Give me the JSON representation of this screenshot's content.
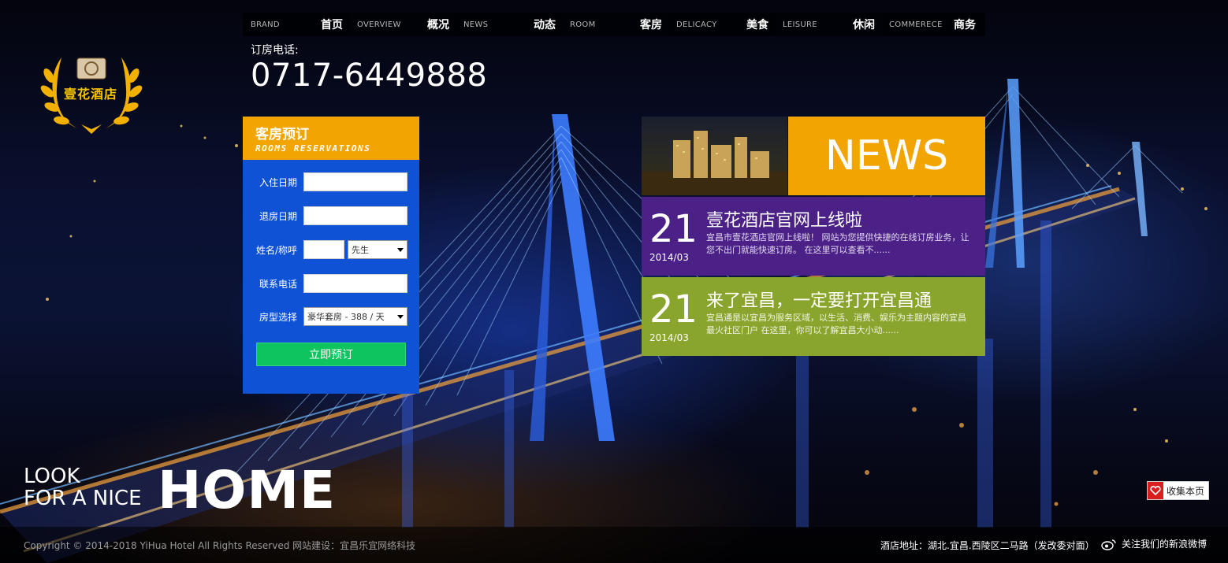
{
  "nav": [
    {
      "en": "BRAND",
      "cn": "首页"
    },
    {
      "en": "OVERVIEW",
      "cn": "概况"
    },
    {
      "en": "NEWS",
      "cn": "动态"
    },
    {
      "en": "ROOM",
      "cn": "客房"
    },
    {
      "en": "DELICACY",
      "cn": "美食"
    },
    {
      "en": "LEISURE",
      "cn": "休闲"
    },
    {
      "en": "COMMERECE",
      "cn": "商务"
    }
  ],
  "logo": {
    "text": "壹花酒店",
    "icon": "laurel-wreath-logo"
  },
  "phone": {
    "label": "订房电话:",
    "number": "0717-6449888"
  },
  "reservation": {
    "title": "客房预订",
    "subtitle": "ROOMS RESERVATIONS",
    "checkin_label": "入住日期",
    "checkout_label": "退房日期",
    "name_label": "姓名/称呼",
    "title_select": "先生",
    "phone_label": "联系电话",
    "room_label": "房型选择",
    "room_select": "豪华套房 - 388 / 天",
    "submit_label": "立即预订"
  },
  "news": {
    "header": "NEWS",
    "items": [
      {
        "day": "21",
        "date": "2014/03",
        "title": "壹花酒店官网上线啦",
        "desc": "宜昌市壹花酒店官网上线啦！ 网站为您提供快捷的在线订房业务，让您不出门就能快速订房。 在这里可以查看不......"
      },
      {
        "day": "21",
        "date": "2014/03",
        "title": "来了宜昌，一定要打开宜昌通",
        "desc": "宜昌通是以宜昌为服务区域，以生活、消费、娱乐为主题内容的宜昌最火社区门户 在这里，你可以了解宜昌大小动......"
      }
    ]
  },
  "slogan": {
    "line1": "LOOK",
    "line2": "FOR A NICE",
    "big": "HOME"
  },
  "footer": {
    "copyright": "Copyright © 2014-2018 YiHua Hotel All Rights Reserved 网站建设：宜昌乐宜网络科技",
    "address": "酒店地址：湖北.宜昌.西陵区二马路（发改委对面）",
    "weibo": "关注我们的新浪微博"
  },
  "favorite": {
    "label": "收集本页"
  },
  "colors": {
    "orange": "#f2a500",
    "blue": "#0f52d6",
    "purple": "#4b2187",
    "green": "#8aa52e",
    "button": "#0ec45f"
  }
}
